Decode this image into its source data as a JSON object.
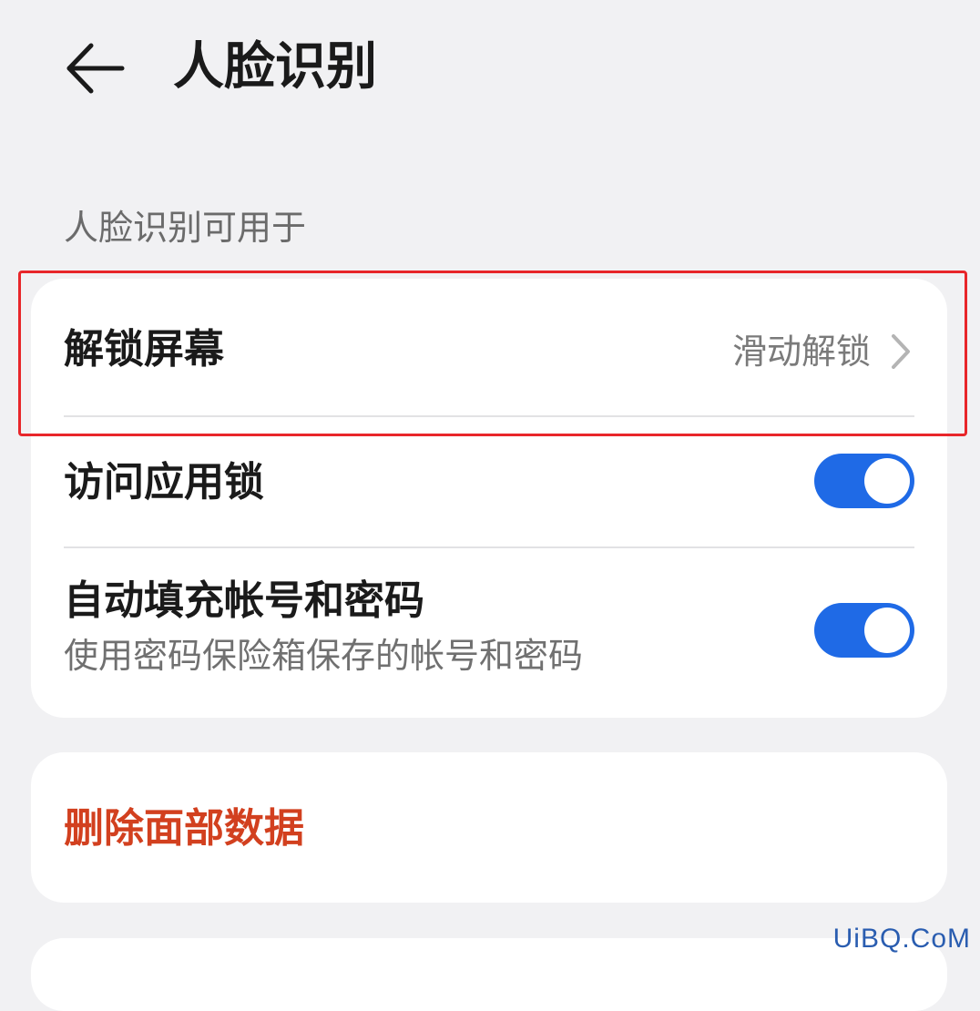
{
  "header": {
    "title": "人脸识别",
    "back_icon": "arrow-left-icon"
  },
  "section": {
    "label": "人脸识别可用于"
  },
  "settings": {
    "unlock_screen": {
      "title": "解锁屏幕",
      "value": "滑动解锁",
      "chevron_icon": "chevron-right-icon"
    },
    "app_lock": {
      "title": "访问应用锁",
      "enabled": true
    },
    "autofill": {
      "title": "自动填充帐号和密码",
      "subtitle": "使用密码保险箱保存的帐号和密码",
      "enabled": true
    }
  },
  "delete": {
    "label": "删除面部数据"
  },
  "watermark": {
    "text": "UiBQ.CoM"
  },
  "colors": {
    "background": "#f1f1f3",
    "card": "#ffffff",
    "toggle_on": "#1f6ae6",
    "destructive": "#d2401f",
    "highlight": "#e8262a"
  }
}
